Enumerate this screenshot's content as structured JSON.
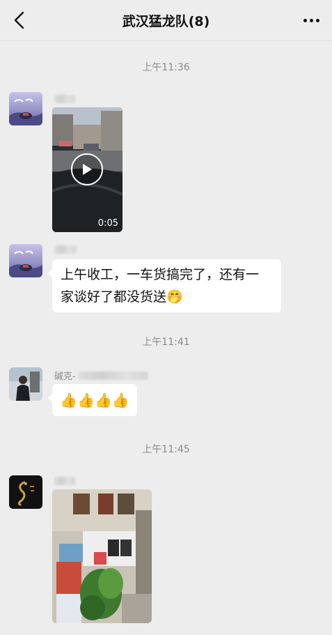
{
  "header": {
    "title": "武汉猛龙队(8)"
  },
  "messages": [
    {
      "time": "上午11:36",
      "video_duration": "0:05"
    },
    {
      "text_line1": "上午收工，一车货搞完了，还有一",
      "text_line2": "家谈好了都没货送🤭"
    },
    {
      "time": "上午11:41",
      "sender_visible": "碱克-",
      "emoji_text": "👍👍👍👍"
    },
    {
      "time": "上午11:45"
    }
  ],
  "icons": {
    "back": "chevron-left-icon",
    "more": "more-dots-icon",
    "play": "play-icon"
  },
  "colors": {
    "background": "#ededed",
    "bubble": "#ffffff",
    "timestamp": "#8a8a8a"
  }
}
